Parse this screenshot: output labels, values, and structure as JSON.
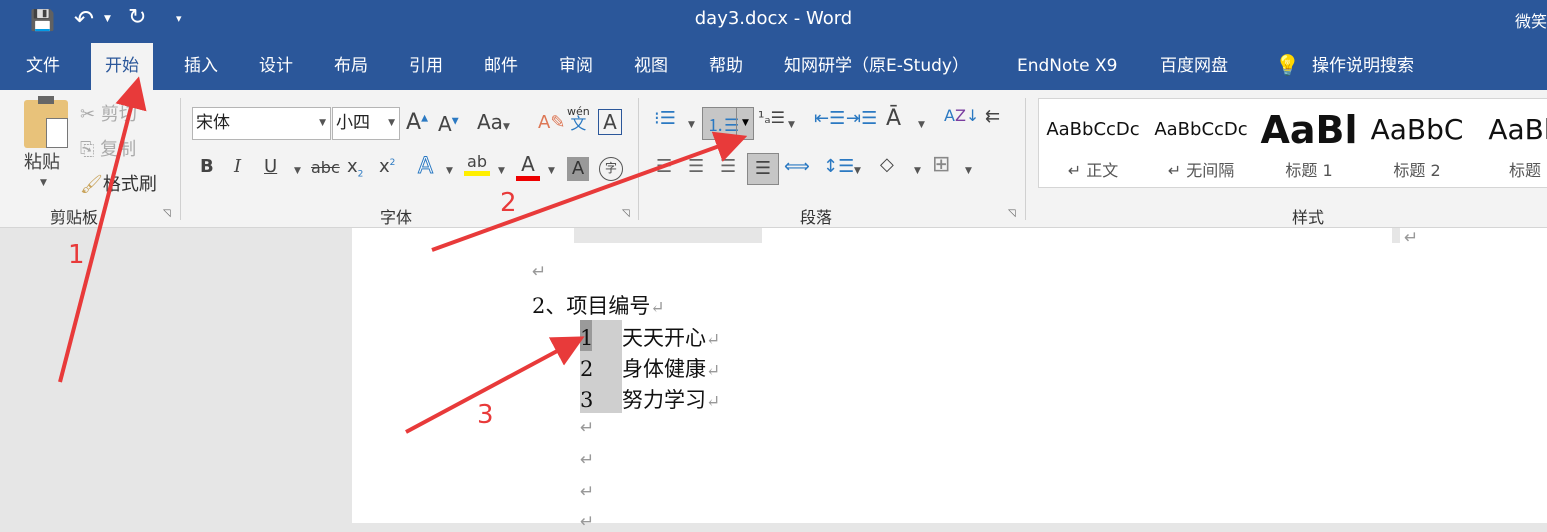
{
  "titlebar": {
    "title": "day3.docx  -  Word",
    "user": "微笑",
    "icons": [
      "save-icon",
      "undo-icon",
      "redo-icon",
      "customize-qat-icon"
    ]
  },
  "tabs": [
    {
      "label": "文件"
    },
    {
      "label": "开始",
      "active": true
    },
    {
      "label": "插入"
    },
    {
      "label": "设计"
    },
    {
      "label": "布局"
    },
    {
      "label": "引用"
    },
    {
      "label": "邮件"
    },
    {
      "label": "审阅"
    },
    {
      "label": "视图"
    },
    {
      "label": "帮助"
    },
    {
      "label": "知网研学（原E-Study）"
    },
    {
      "label": "EndNote X9"
    },
    {
      "label": "百度网盘"
    }
  ],
  "tell_me": "操作说明搜索",
  "clipboard": {
    "paste": "粘贴",
    "cut": "剪切",
    "copy": "复制",
    "format_painter": "格式刷",
    "label": "剪贴板"
  },
  "font": {
    "name": "宋体",
    "size": "小四",
    "label": "字体",
    "change_case": "Aa",
    "phonetic": "wén",
    "phonetic_char": "文",
    "bold": "B",
    "italic": "I",
    "underline": "U",
    "strike": "abc",
    "sub": "x",
    "sup": "x",
    "enclose": "字"
  },
  "paragraph": {
    "label": "段落"
  },
  "styles": {
    "label": "样式",
    "items": [
      {
        "preview": "AaBbCcDc",
        "name": "↵ 正文"
      },
      {
        "preview": "AaBbCcDc",
        "name": "↵ 无间隔"
      },
      {
        "preview": "AaBl",
        "name": "标题 1"
      },
      {
        "preview": "AaBbC",
        "name": "标题 2"
      },
      {
        "preview": "AaBb",
        "name": "标题"
      }
    ]
  },
  "document": {
    "mark": "↵",
    "heading": "2、项目编号",
    "list": [
      {
        "num": "1",
        "text": "天天开心"
      },
      {
        "num": "2",
        "text": "身体健康"
      },
      {
        "num": "3",
        "text": "努力学习"
      }
    ]
  },
  "annotations": [
    "1",
    "2",
    "3"
  ],
  "colors": {
    "brand": "#2b579a",
    "arrow": "#e83a3a"
  }
}
